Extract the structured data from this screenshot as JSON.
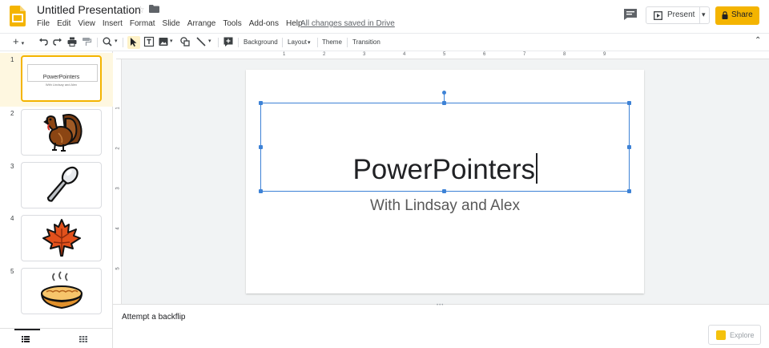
{
  "header": {
    "title": "Untitled Presentation",
    "menus": [
      "File",
      "Edit",
      "View",
      "Insert",
      "Format",
      "Slide",
      "Arrange",
      "Tools",
      "Add-ons",
      "Help"
    ],
    "save_status": "All changes saved in Drive",
    "present_label": "Present",
    "share_label": "Share"
  },
  "toolbar": {
    "background_label": "Background",
    "layout_label": "Layout",
    "theme_label": "Theme",
    "transition_label": "Transition"
  },
  "ruler": {
    "top_numbers": [
      "1",
      "2",
      "3",
      "4",
      "5",
      "6",
      "7",
      "8",
      "9"
    ],
    "left_numbers": [
      "1",
      "2",
      "3",
      "4",
      "5"
    ]
  },
  "filmstrip": {
    "slides": [
      {
        "number": "1",
        "title": "PowerPointers",
        "subtitle": "With Lindsay and Alex"
      },
      {
        "number": "2",
        "icon": "turkey-icon"
      },
      {
        "number": "3",
        "icon": "spoon-icon"
      },
      {
        "number": "4",
        "icon": "maple-leaf-icon"
      },
      {
        "number": "5",
        "icon": "pie-icon"
      }
    ]
  },
  "slide": {
    "title": "PowerPointers",
    "subtitle": "With Lindsay and Alex"
  },
  "notes": {
    "text": "Attempt a backflip"
  },
  "explore": {
    "label": "Explore"
  },
  "colors": {
    "accent": "#f4b400",
    "selection": "#3d82d6"
  }
}
